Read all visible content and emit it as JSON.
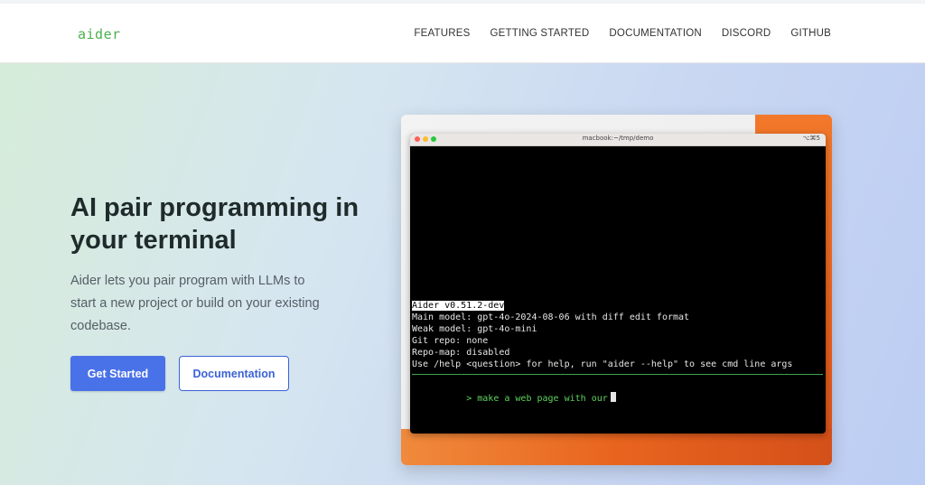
{
  "brand": {
    "logo": "aider",
    "accent": "#4caf50"
  },
  "nav": {
    "items": [
      "FEATURES",
      "GETTING STARTED",
      "DOCUMENTATION",
      "DISCORD",
      "GITHUB"
    ]
  },
  "hero": {
    "title": "AI pair programming in your terminal",
    "description": "Aider lets you pair program with LLMs to start a new project or build on your existing codebase.",
    "primary_button": "Get Started",
    "secondary_button": "Documentation",
    "primary_color": "#4a72e8"
  },
  "terminal": {
    "title": "macbook:~/tmp/demo",
    "shortcut": "⌥⌘5",
    "lines": [
      "Aider v0.51.2-dev",
      "Main model: gpt-4o-2024-08-06 with diff edit format",
      "Weak model: gpt-4o-mini",
      "Git repo: none",
      "Repo-map: disabled",
      "Use /help <question> for help, run \"aider --help\" to see cmd line args"
    ],
    "prompt": "> make a web page with our"
  }
}
